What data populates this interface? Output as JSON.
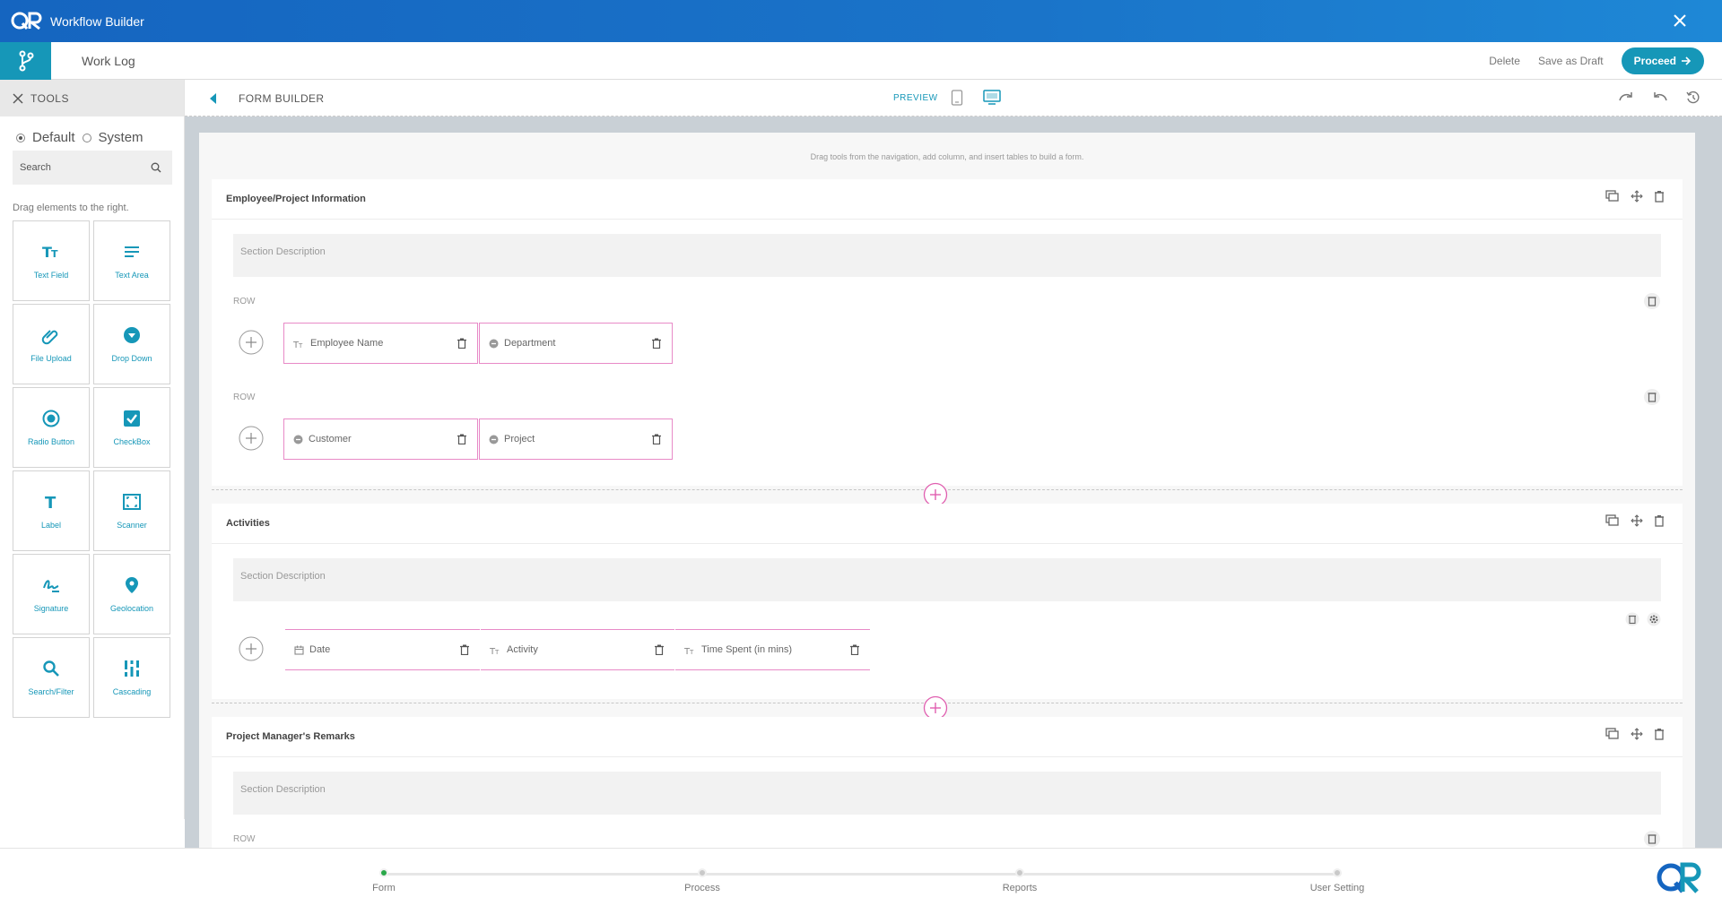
{
  "app": {
    "title": "Workflow Builder"
  },
  "subbar": {
    "tab": "Work Log",
    "delete_label": "Delete",
    "draft_label": "Save as Draft",
    "proceed_label": "Proceed"
  },
  "sidebar": {
    "heading": "TOOLS",
    "radio_default": "Default",
    "radio_system": "System",
    "search_placeholder": "Search",
    "hint": "Drag elements to the right.",
    "tools": [
      "Text Field",
      "Text Area",
      "File Upload",
      "Drop Down",
      "Radio Button",
      "CheckBox",
      "Label",
      "Scanner",
      "Signature",
      "Geolocation",
      "Search/Filter",
      "Cascading"
    ]
  },
  "builder": {
    "title": "FORM BUILDER",
    "preview": "PREVIEW",
    "hint": "Drag tools from the navigation, add column, and insert tables to build a form."
  },
  "sections": [
    {
      "title": "Employee/Project Information",
      "description": "Section Description",
      "row_label": "ROW",
      "rows": [
        [
          "Employee Name",
          "Department"
        ],
        [
          "Customer",
          "Project"
        ]
      ]
    },
    {
      "title": "Activities",
      "description": "Section Description",
      "columns": [
        "Date",
        "Activity",
        "Time Spent (in mins)"
      ]
    },
    {
      "title": "Project Manager's Remarks",
      "description": "Section Description",
      "row_label": "ROW"
    }
  ],
  "steps": [
    "Form",
    "Process",
    "Reports",
    "User Setting"
  ],
  "colors": {
    "accent": "#1697b8",
    "pink": "#e88ac7",
    "header_blue": "#1565c0",
    "step_active": "#2aa84a"
  }
}
